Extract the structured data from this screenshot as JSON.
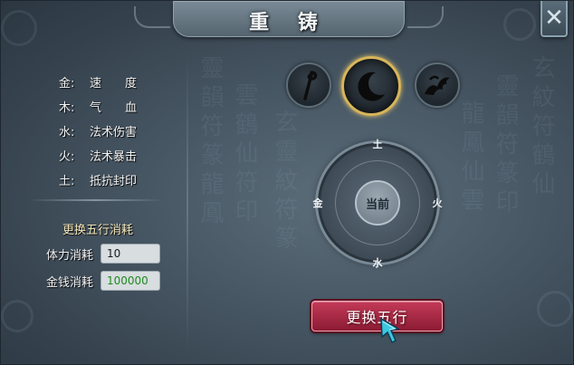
{
  "window": {
    "title": "重 铸"
  },
  "close_glyph": "✕",
  "attributes": [
    {
      "element": "金:",
      "effect": "速　　度"
    },
    {
      "element": "木:",
      "effect": "气　　血"
    },
    {
      "element": "水:",
      "effect": "法术伤害"
    },
    {
      "element": "火:",
      "effect": "法术暴击"
    },
    {
      "element": "土:",
      "effect": "抵抗封印"
    }
  ],
  "cost": {
    "title": "更换五行消耗",
    "stamina_label": "体力消耗",
    "stamina_value": "10",
    "money_label": "金钱消耗",
    "money_value": "100000"
  },
  "element_icons": [
    {
      "name": "staff-icon",
      "selected": false
    },
    {
      "name": "crescent-moon-icon",
      "selected": true
    },
    {
      "name": "dragon-icon",
      "selected": false
    }
  ],
  "dial": {
    "center": "当前",
    "top": "土",
    "left": "金",
    "right": "火",
    "bottom": "水"
  },
  "primary_button": "更换五行",
  "colors": {
    "button": "#b22d4a",
    "selected_ring": "#d8b55a",
    "money_text": "#1f8a1f",
    "cost_title": "#f4e7b9"
  }
}
